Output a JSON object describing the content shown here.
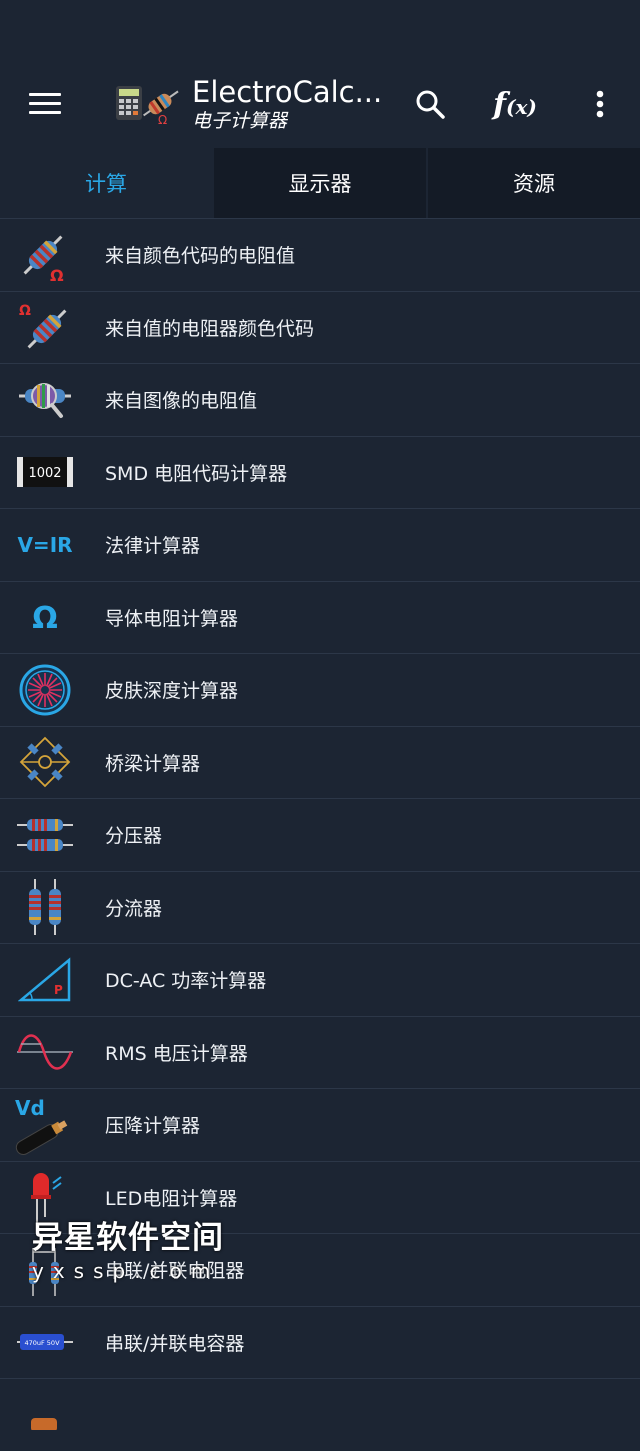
{
  "app": {
    "title": "ElectroCalc...",
    "subtitle": "电子计算器",
    "fx_label": "f",
    "fx_arg": "(x)"
  },
  "tabs": [
    {
      "label": "计算"
    },
    {
      "label": "显示器"
    },
    {
      "label": "资源"
    }
  ],
  "items": [
    {
      "label": "来自颜色代码的电阻值",
      "icon": "resistor-ohm-icon"
    },
    {
      "label": "来自值的电阻器颜色代码",
      "icon": "resistor-color-code-icon"
    },
    {
      "label": "来自图像的电阻值",
      "icon": "resistor-magnifier-icon"
    },
    {
      "label": "SMD 电阻代码计算器",
      "icon": "smd-resistor-icon",
      "icon_text": "1002"
    },
    {
      "label": "法律计算器",
      "icon": "ohms-law-icon",
      "icon_text": "V=IR"
    },
    {
      "label": "导体电阻计算器",
      "icon": "omega-icon",
      "icon_text": "Ω"
    },
    {
      "label": "皮肤深度计算器",
      "icon": "skin-depth-icon"
    },
    {
      "label": "桥梁计算器",
      "icon": "bridge-icon"
    },
    {
      "label": "分压器",
      "icon": "voltage-divider-icon"
    },
    {
      "label": "分流器",
      "icon": "current-divider-icon"
    },
    {
      "label": "DC-AC 功率计算器",
      "icon": "power-triangle-icon",
      "icon_text": "P"
    },
    {
      "label": "RMS 电压计算器",
      "icon": "sine-wave-icon"
    },
    {
      "label": "压降计算器",
      "icon": "cable-icon",
      "icon_text": "Vd"
    },
    {
      "label": "LED电阻计算器",
      "icon": "led-icon"
    },
    {
      "label": "串联/并联电阻器",
      "icon": "series-parallel-resistor-icon"
    },
    {
      "label": "串联/并联电容器",
      "icon": "capacitor-icon",
      "icon_text": "470uF 50V"
    }
  ],
  "watermark": {
    "line1": "异星软件空间",
    "line2": "yxssp.com"
  },
  "colors": {
    "background": "#1c2533",
    "tab_inactive": "#141b26",
    "accent": "#2aa7e6"
  }
}
